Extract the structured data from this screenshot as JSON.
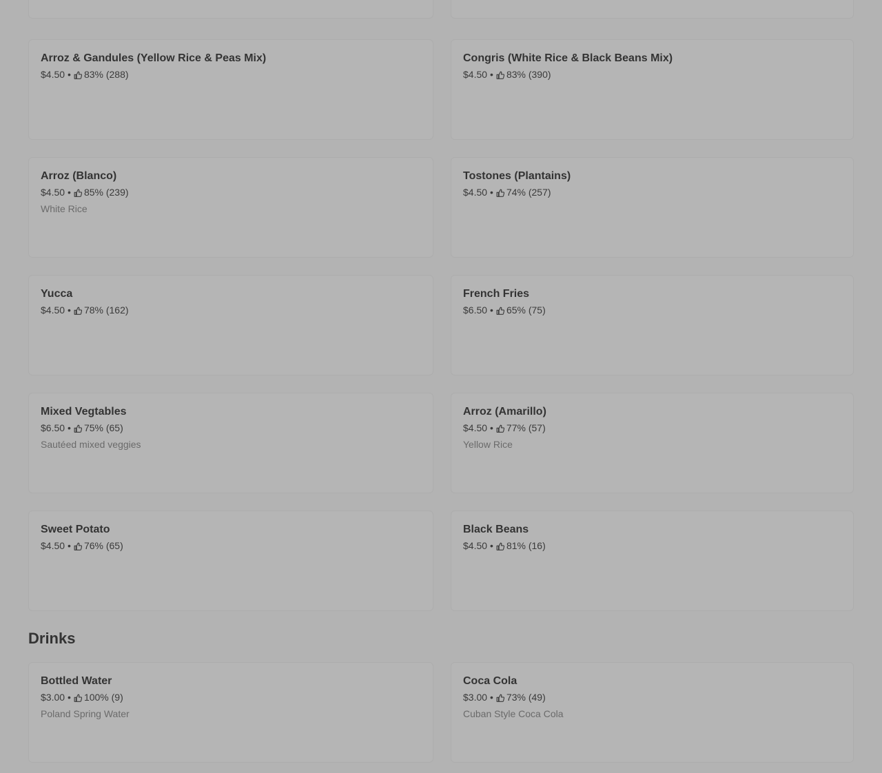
{
  "sides": {
    "items": [
      {
        "name": "Arroz & Gandules (Yellow Rice & Peas Mix)",
        "price": "$4.50",
        "rating": "83% (288)",
        "desc": ""
      },
      {
        "name": "Congris (White Rice & Black Beans Mix)",
        "price": "$4.50",
        "rating": "83% (390)",
        "desc": ""
      },
      {
        "name": "Arroz (Blanco)",
        "price": "$4.50",
        "rating": "85% (239)",
        "desc": "White Rice"
      },
      {
        "name": "Tostones (Plantains)",
        "price": "$4.50",
        "rating": "74% (257)",
        "desc": ""
      },
      {
        "name": "Yucca",
        "price": "$4.50",
        "rating": "78% (162)",
        "desc": ""
      },
      {
        "name": "French Fries",
        "price": "$6.50",
        "rating": "65% (75)",
        "desc": ""
      },
      {
        "name": "Mixed Vegtables",
        "price": "$6.50",
        "rating": "75% (65)",
        "desc": "Sautéed mixed veggies"
      },
      {
        "name": "Arroz (Amarillo)",
        "price": "$4.50",
        "rating": "77% (57)",
        "desc": "Yellow Rice"
      },
      {
        "name": "Sweet Potato",
        "price": "$4.50",
        "rating": "76% (65)",
        "desc": ""
      },
      {
        "name": "Black Beans",
        "price": "$4.50",
        "rating": "81% (16)",
        "desc": ""
      }
    ]
  },
  "drinks": {
    "heading": "Drinks",
    "items": [
      {
        "name": "Bottled Water",
        "price": "$3.00",
        "rating": "100% (9)",
        "desc": "Poland Spring Water"
      },
      {
        "name": "Coca Cola",
        "price": "$3.00",
        "rating": "73% (49)",
        "desc": "Cuban Style Coca Cola"
      }
    ]
  },
  "separator": "•",
  "icons": {
    "rating": "thumbs-up-icon"
  },
  "colors": {
    "background": "#b3b3b3",
    "text": "#333333",
    "muted": "#6a6a6a"
  }
}
